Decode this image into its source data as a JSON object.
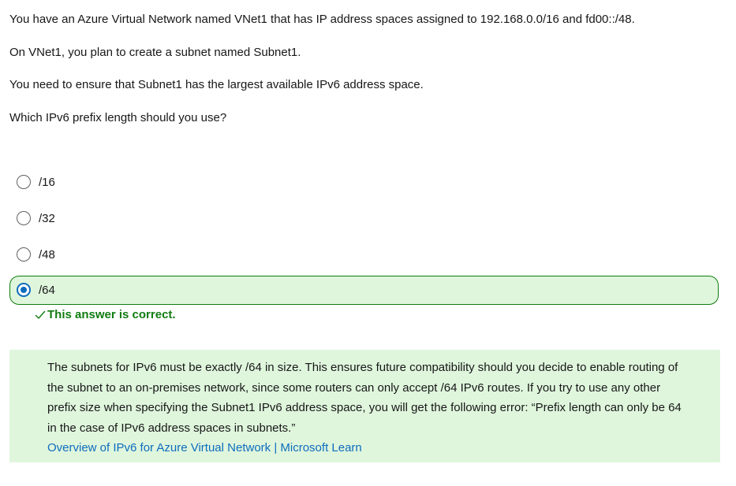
{
  "question": {
    "line1": "You have an Azure Virtual Network named VNet1 that has IP address spaces assigned to 192.168.0.0/16 and fd00::/48.",
    "line2": "On VNet1, you plan to create a subnet named Subnet1.",
    "line3": "You need to ensure that Subnet1 has the largest available IPv6 address space.",
    "line4": "Which IPv6 prefix length should you use?"
  },
  "options": [
    {
      "label": "/16",
      "selected": false
    },
    {
      "label": "/32",
      "selected": false
    },
    {
      "label": "/48",
      "selected": false
    },
    {
      "label": "/64",
      "selected": true
    }
  ],
  "feedback": {
    "text": "This answer is correct.",
    "icon": "checkmark-icon"
  },
  "explanation": {
    "text": "The subnets for IPv6 must be exactly /64 in size. This ensures future compatibility should you decide to enable routing of the subnet to an on-premises network, since some routers can only accept /64 IPv6 routes. If you try to use any other prefix size when specifying the Subnet1 IPv6 address space, you will get the following error: “Prefix length can only be 64 in the case of IPv6 address spaces in subnets.”",
    "link_text": "Overview of IPv6 for Azure Virtual Network | Microsoft Learn"
  },
  "colors": {
    "correct_green": "#107c10",
    "correct_bg": "#dff6dd",
    "radio_blue": "#0f6cbd",
    "link_blue": "#0f6cbd"
  }
}
